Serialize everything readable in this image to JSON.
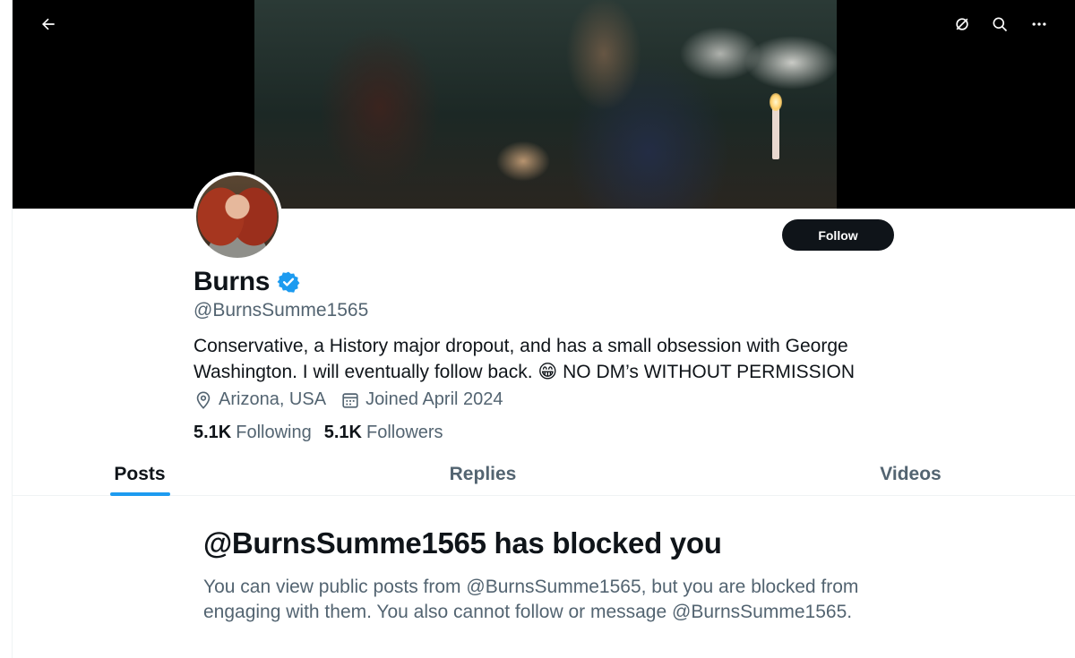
{
  "header": {
    "back_icon": "arrow-left-icon",
    "grok_icon": "grok-icon",
    "search_icon": "search-icon",
    "more_icon": "more-horizontal-icon"
  },
  "profile": {
    "name": "Burns",
    "verified": true,
    "handle": "@BurnsSumme1565",
    "bio": "Conservative, a History major dropout, and has a small obsession with George Washington. I will eventually follow back. 😁 NO DM’s WITHOUT PERMISSION",
    "location": "Arizona, USA",
    "joined": "Joined April 2024",
    "following_count": "5.1K",
    "following_label": "Following",
    "followers_count": "5.1K",
    "followers_label": "Followers",
    "follow_button": "Follow"
  },
  "tabs": [
    {
      "label": "Posts",
      "active": true
    },
    {
      "label": "Replies",
      "active": false
    },
    {
      "label": "Videos",
      "active": false
    }
  ],
  "blocked": {
    "title": "@BurnsSumme1565 has blocked you",
    "description": "You can view public posts from @BurnsSumme1565, but you are blocked from engaging with them. You also cannot follow or message @BurnsSumme1565."
  },
  "colors": {
    "accent": "#1d9bf0",
    "text_primary": "#0f1419",
    "text_secondary": "#536471",
    "follow_button_bg": "#0f1419"
  }
}
